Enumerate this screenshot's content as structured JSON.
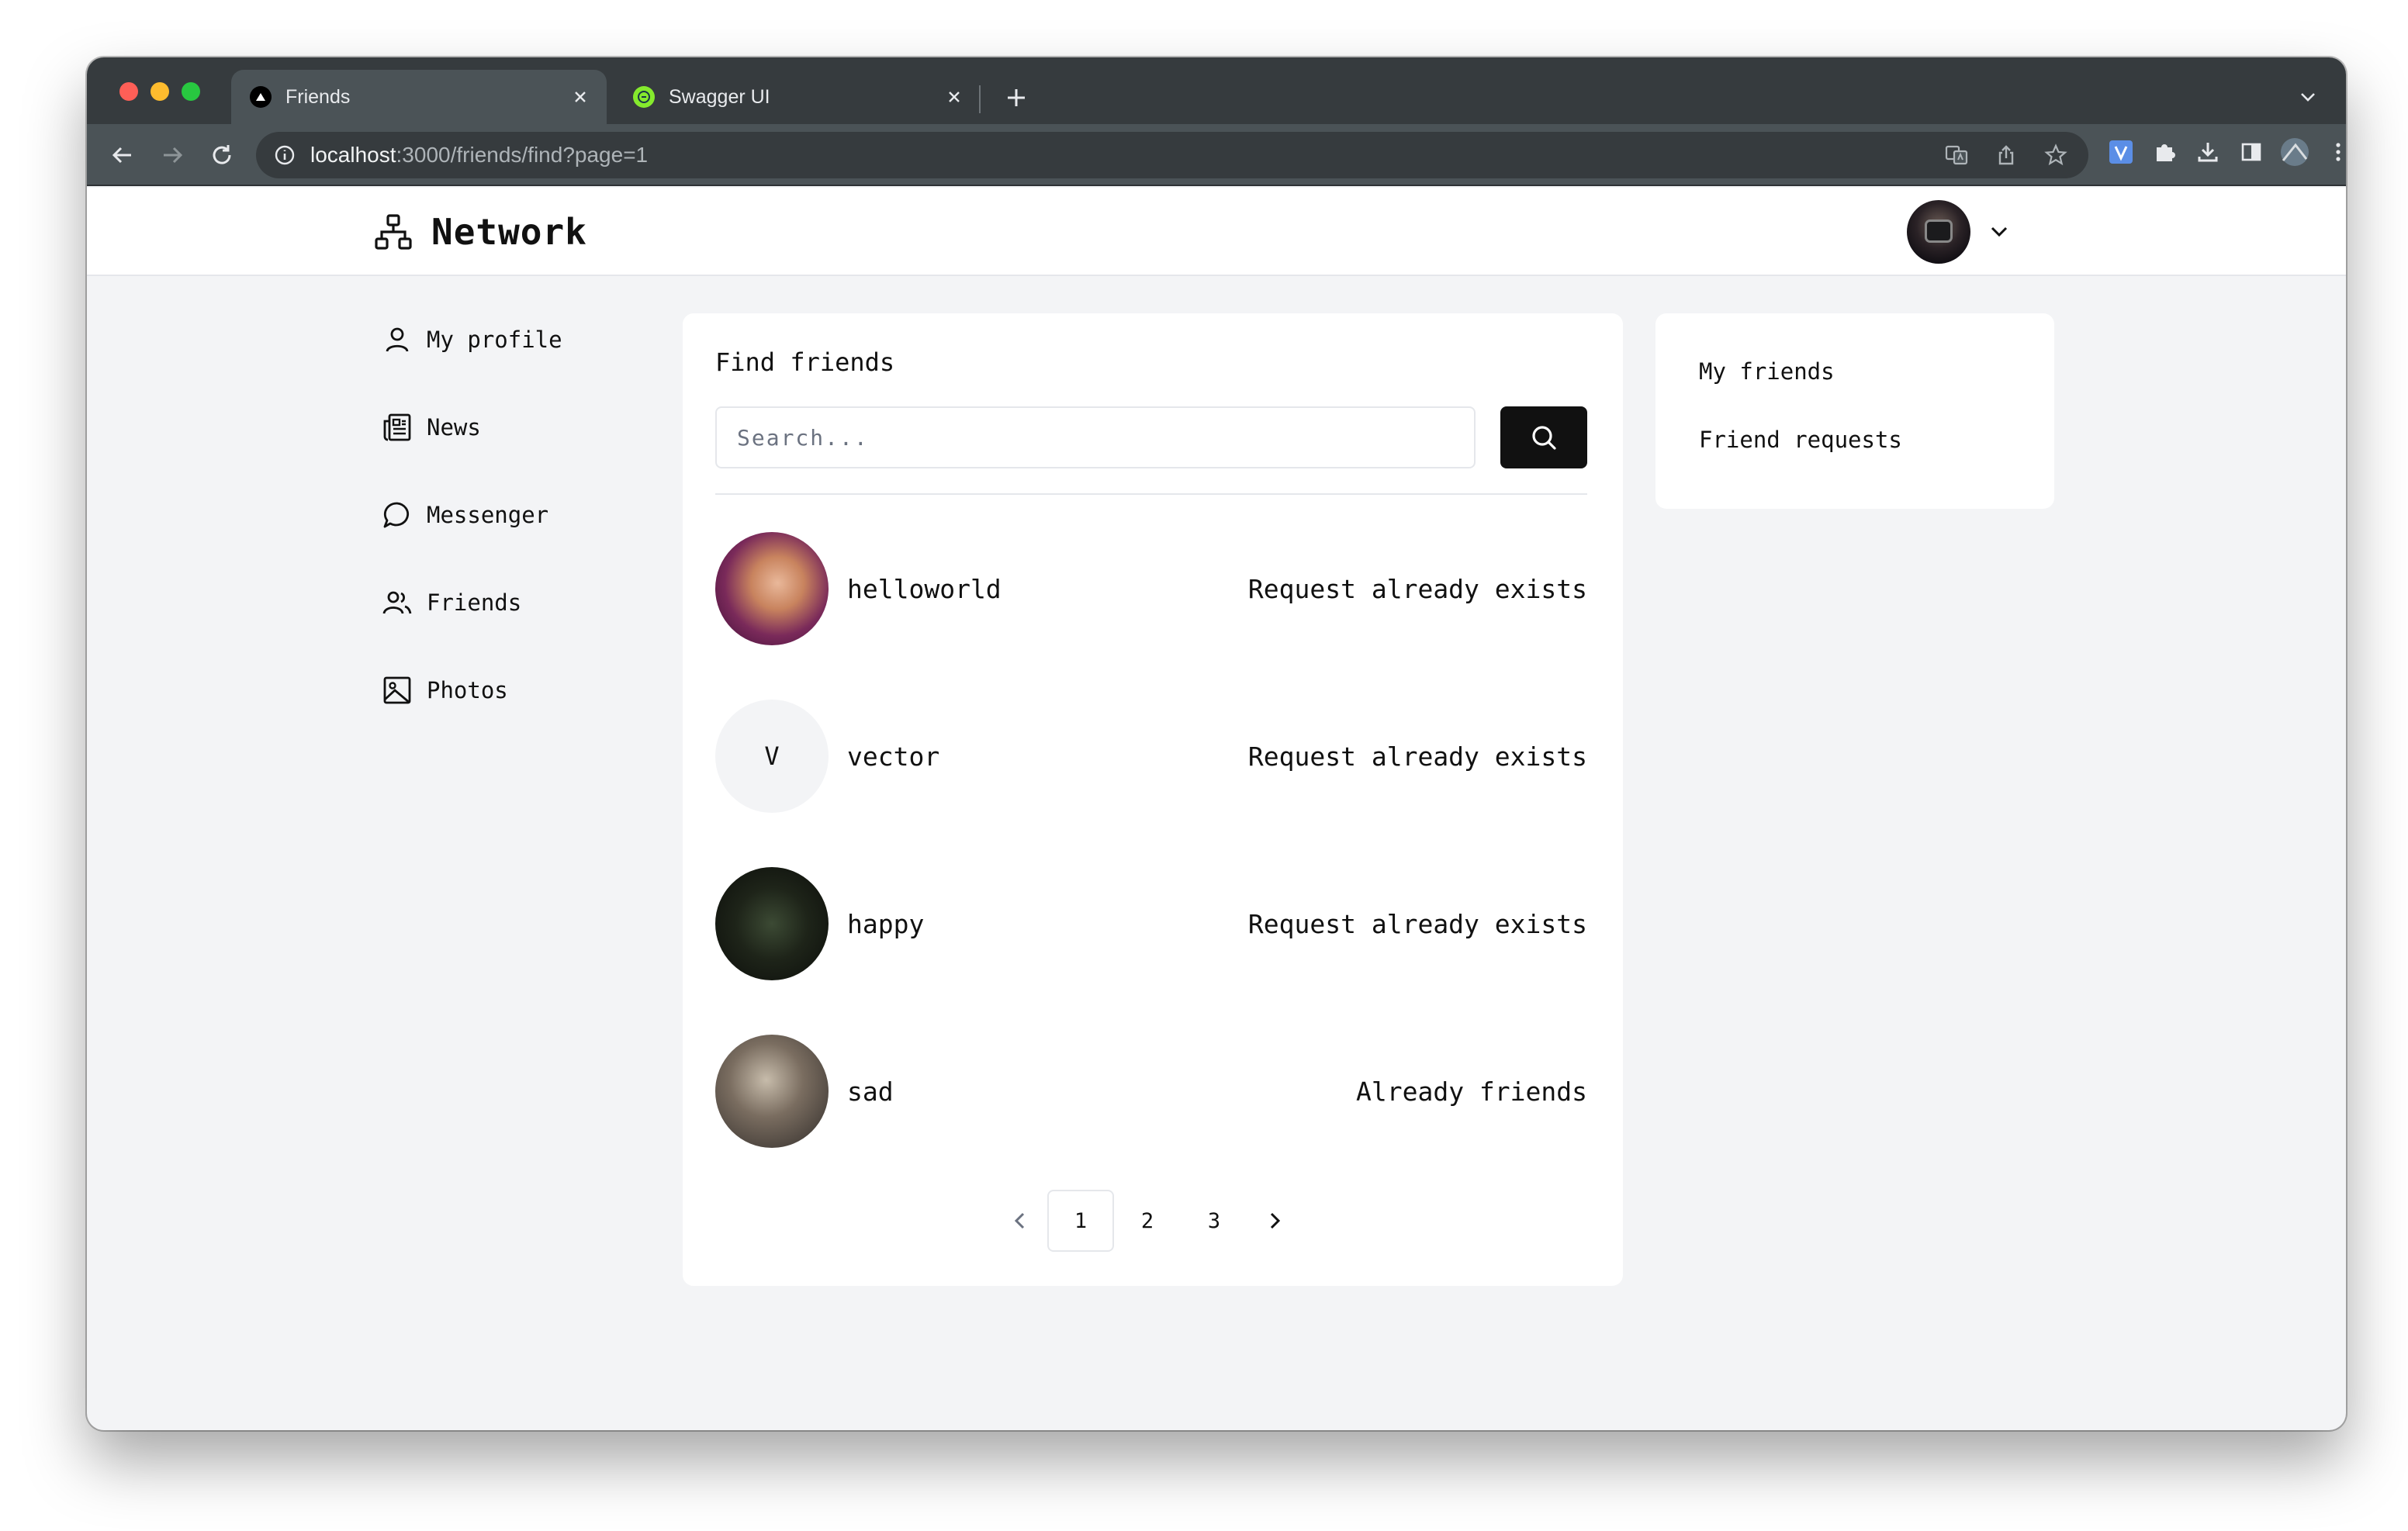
{
  "browser": {
    "tabs": [
      {
        "title": "Friends",
        "icon": "vercel-icon"
      },
      {
        "title": "Swagger UI",
        "icon": "swagger-icon"
      }
    ],
    "url_host": "localhost",
    "url_path": ":3000/friends/find?page=1"
  },
  "header": {
    "brand": "Network"
  },
  "sidebar": {
    "items": [
      {
        "label": "My profile",
        "icon": "user-icon"
      },
      {
        "label": "News",
        "icon": "newspaper-icon"
      },
      {
        "label": "Messenger",
        "icon": "chat-bubble-icon"
      },
      {
        "label": "Friends",
        "icon": "users-icon"
      },
      {
        "label": "Photos",
        "icon": "photo-icon"
      }
    ]
  },
  "main": {
    "title": "Find friends",
    "search_placeholder": "Search...",
    "users": [
      {
        "name": "helloworld",
        "status": "Request already exists",
        "initial": ""
      },
      {
        "name": "vector",
        "status": "Request already exists",
        "initial": "V"
      },
      {
        "name": "happy",
        "status": "Request already exists",
        "initial": ""
      },
      {
        "name": "sad",
        "status": "Already friends",
        "initial": ""
      }
    ],
    "pagination": {
      "pages": [
        "1",
        "2",
        "3"
      ],
      "current": "1"
    }
  },
  "right_panel": {
    "links": [
      "My friends",
      "Friend requests"
    ]
  }
}
